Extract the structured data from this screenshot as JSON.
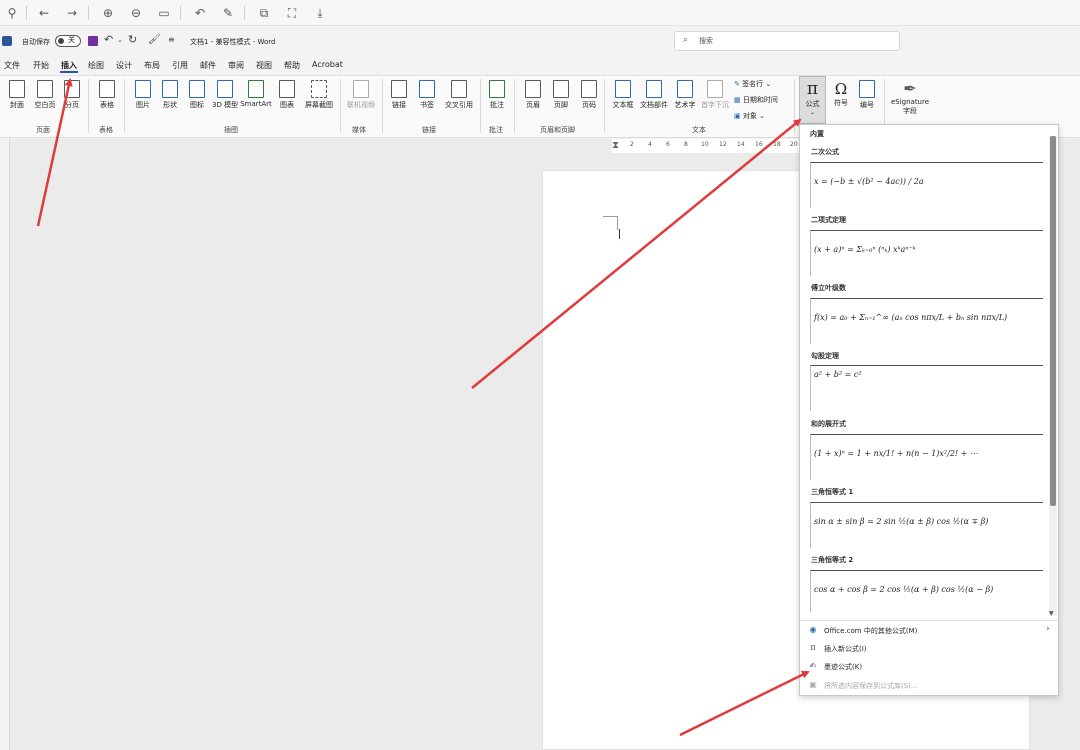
{
  "title_bar": {
    "autosave_label": "自动保存",
    "autosave_state": "关",
    "doc_title": "文档1",
    "mode": "兼容性模式",
    "app_name": "Word",
    "separator": "-",
    "search_placeholder": "搜索"
  },
  "tabs": [
    "文件",
    "开始",
    "插入",
    "绘图",
    "设计",
    "布局",
    "引用",
    "邮件",
    "审阅",
    "视图",
    "帮助",
    "Acrobat"
  ],
  "active_tab": "插入",
  "ribbon": {
    "pages_group": {
      "label": "页面",
      "cover": "封面",
      "blank": "空白页",
      "break": "分页"
    },
    "table_group": {
      "label": "表格",
      "table": "表格"
    },
    "illustrations_group": {
      "label": "插图",
      "picture": "图片",
      "shapes": "形状",
      "icons": "图标",
      "model_3d": "3D 模型",
      "smartart": "SmartArt",
      "chart": "图表",
      "screenshot": "屏幕截图"
    },
    "media_group": {
      "label": "媒体",
      "online_video": "联机视频"
    },
    "links_group": {
      "label": "链接",
      "link": "链接",
      "bookmark": "书签",
      "crossref": "交叉引用"
    },
    "comments_group": {
      "label": "批注",
      "comment": "批注"
    },
    "header_footer_group": {
      "label": "页眉和页脚",
      "header": "页眉",
      "footer": "页脚",
      "page_number": "页码"
    },
    "text_group": {
      "label": "文本",
      "textbox": "文本框",
      "quickparts": "文档部件",
      "wordart": "艺术字",
      "dropcap": "首字下沉",
      "signature": "签名行",
      "datetime": "日期和时间",
      "object": "对象"
    },
    "symbols_group": {
      "equation": "公式",
      "symbol": "符号",
      "number": "编号"
    },
    "esign": {
      "line1": "eSignature",
      "line2": "字段"
    }
  },
  "ruler_ticks": [
    "2",
    "4",
    "6",
    "8",
    "10",
    "12",
    "14",
    "16",
    "18",
    "20"
  ],
  "equation_menu": {
    "section_label": "内置",
    "items": [
      {
        "title": "二次公式",
        "formula": "x = (−b ± √(b² − 4ac)) / 2a"
      },
      {
        "title": "二项式定理",
        "formula": "(x + a)ⁿ = Σₖ₌₀ⁿ (ⁿₖ) xᵏaⁿ⁻ᵏ"
      },
      {
        "title": "傅立叶级数",
        "formula": "f(x) = a₀ + Σₙ₌₁^∞ (aₙ cos nπx/L + bₙ sin nπx/L)"
      },
      {
        "title": "勾股定理",
        "formula": "a² + b² = c²"
      },
      {
        "title": "和的展开式",
        "formula": "(1 + x)ⁿ = 1 + nx/1! + n(n − 1)x²/2! + ⋯"
      },
      {
        "title": "三角恒等式 1",
        "formula": "sin α ± sin β = 2 sin ½(α ± β) cos ½(α ∓ β)"
      },
      {
        "title": "三角恒等式 2",
        "formula": "cos α + cos β = 2 cos ½(α + β) cos ½(α − β)"
      }
    ],
    "more_label": "Office.com 中的其他公式(M)",
    "insert_new_label": "插入新公式(I)",
    "ink_label": "墨迹公式(K)",
    "save_label": "将所选内容保存到公式库(S)..."
  }
}
